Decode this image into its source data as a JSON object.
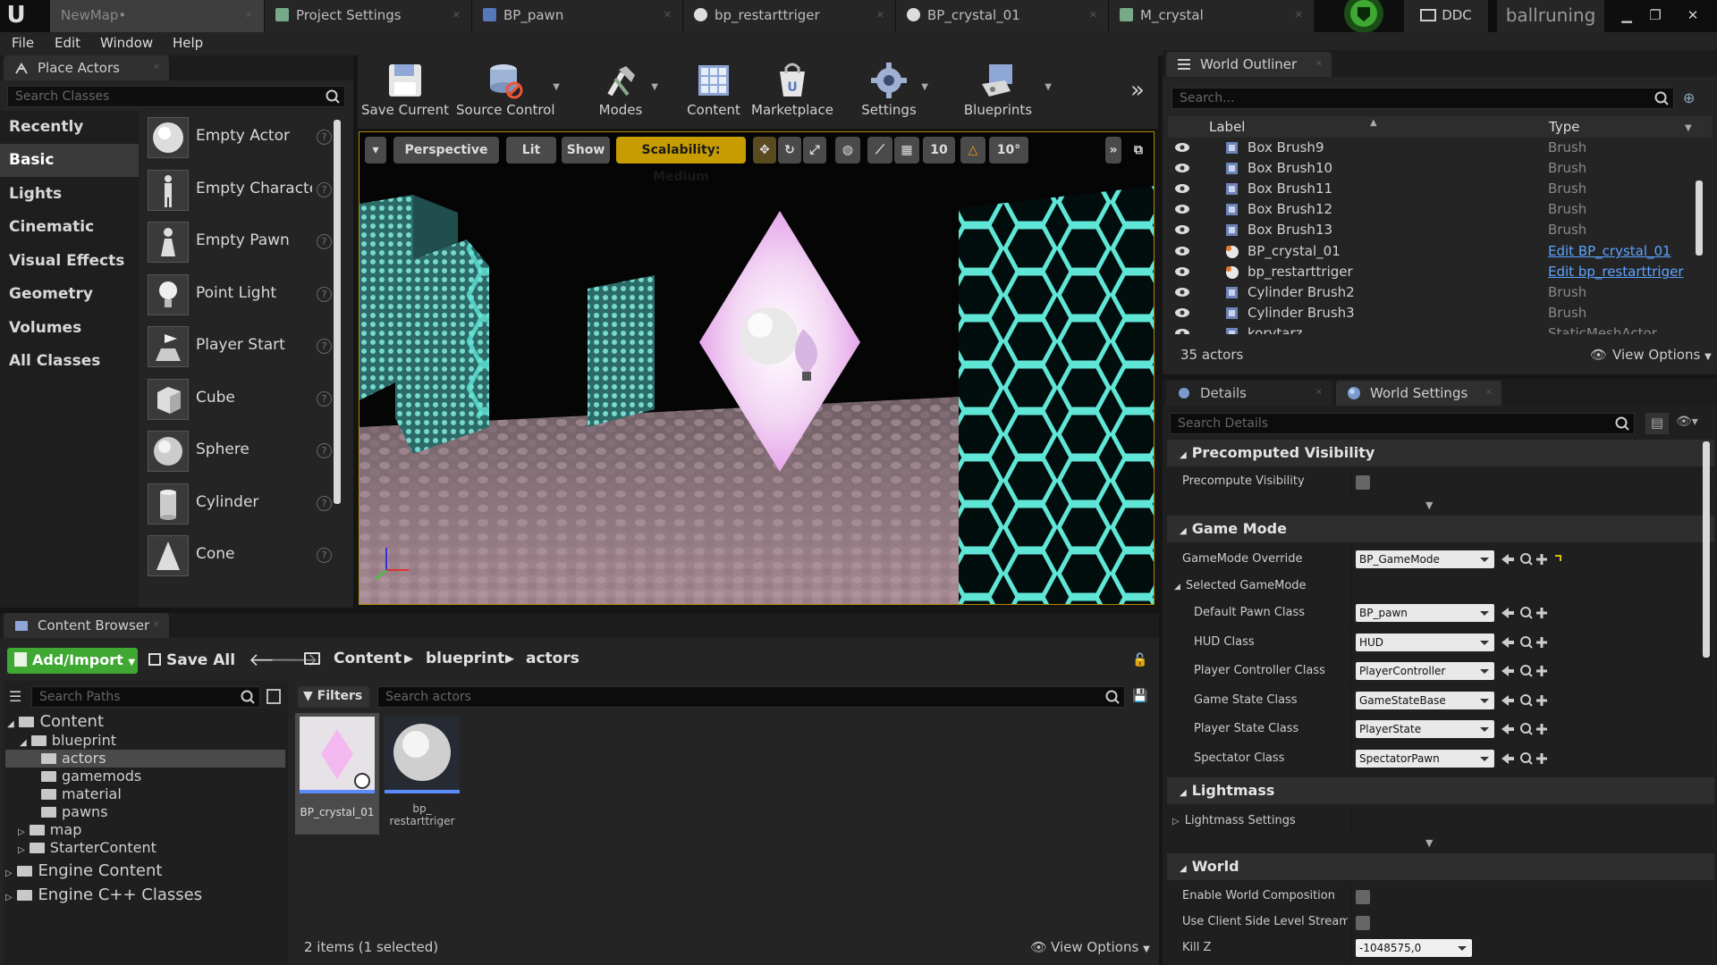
{
  "title_bar": {
    "tabs": [
      {
        "label": "NewMap•",
        "icon": "map-icon"
      },
      {
        "label": "Project Settings",
        "icon": "settings-icon"
      },
      {
        "label": "BP_pawn",
        "icon": "blueprint-icon"
      },
      {
        "label": "bp_restarttriger",
        "icon": "sphere-icon"
      },
      {
        "label": "BP_crystal_01",
        "icon": "sphere-icon"
      },
      {
        "label": "M_crystal",
        "icon": "material-icon"
      }
    ],
    "ddc_label": "DDC",
    "project_name": "ballruning"
  },
  "menu": [
    "File",
    "Edit",
    "Window",
    "Help"
  ],
  "place_actors": {
    "tab_label": "Place Actors",
    "search_placeholder": "Search Classes",
    "categories": [
      "Recently Placed",
      "Basic",
      "Lights",
      "Cinematic",
      "Visual Effects",
      "Geometry",
      "Volumes",
      "All Classes"
    ],
    "selected_category": "Basic",
    "actors": [
      "Empty Actor",
      "Empty Characte",
      "Empty Pawn",
      "Point Light",
      "Player Start",
      "Cube",
      "Sphere",
      "Cylinder",
      "Cone"
    ]
  },
  "toolbar": {
    "buttons": [
      "Save Current",
      "Source Control",
      "Modes",
      "Content",
      "Marketplace",
      "Settings",
      "Blueprints"
    ]
  },
  "viewport": {
    "perspective": "Perspective",
    "lit": "Lit",
    "show": "Show",
    "scalability": "Scalability: Medium",
    "grid_snap": "10",
    "rotation_snap": "10°"
  },
  "outliner": {
    "tab_label": "World Outliner",
    "search_placeholder": "Search...",
    "col_label": "Label",
    "col_type": "Type",
    "rows": [
      {
        "name": "Box Brush9",
        "type": "Brush",
        "link": false,
        "icon": "brush-icon"
      },
      {
        "name": "Box Brush10",
        "type": "Brush",
        "link": false,
        "icon": "brush-icon"
      },
      {
        "name": "Box Brush11",
        "type": "Brush",
        "link": false,
        "icon": "brush-icon"
      },
      {
        "name": "Box Brush12",
        "type": "Brush",
        "link": false,
        "icon": "brush-icon"
      },
      {
        "name": "Box Brush13",
        "type": "Brush",
        "link": false,
        "icon": "brush-icon"
      },
      {
        "name": "BP_crystal_01",
        "type": "Edit BP_crystal_01",
        "link": true,
        "icon": "blueprint-actor-icon"
      },
      {
        "name": "bp_restarttriger",
        "type": "Edit bp_restarttriger",
        "link": true,
        "icon": "blueprint-actor-icon"
      },
      {
        "name": "Cylinder Brush2",
        "type": "Brush",
        "link": false,
        "icon": "brush-icon"
      },
      {
        "name": "Cylinder Brush3",
        "type": "Brush",
        "link": false,
        "icon": "brush-icon"
      },
      {
        "name": "korytarz",
        "type": "StaticMeshActor",
        "link": false,
        "icon": "mesh-icon"
      }
    ],
    "count": "35 actors",
    "view_options": "View Options"
  },
  "details": {
    "tab_details": "Details",
    "tab_world": "World Settings",
    "search_placeholder": "Search Details",
    "sections": {
      "precomputed": "Precomputed Visibility",
      "gamemode": "Game Mode",
      "lightmass": "Lightmass",
      "world": "World"
    },
    "precompute_visibility": "Precompute Visibility",
    "gamemode_override": {
      "label": "GameMode Override",
      "value": "BP_GameMode"
    },
    "selected_gamemode": "Selected GameMode",
    "classes": [
      {
        "label": "Default Pawn Class",
        "value": "BP_pawn"
      },
      {
        "label": "HUD Class",
        "value": "HUD"
      },
      {
        "label": "Player Controller Class",
        "value": "PlayerController"
      },
      {
        "label": "Game State Class",
        "value": "GameStateBase"
      },
      {
        "label": "Player State Class",
        "value": "PlayerState"
      },
      {
        "label": "Spectator Class",
        "value": "SpectatorPawn"
      }
    ],
    "lightmass_settings": "Lightmass Settings",
    "enable_world_composition": "Enable World Composition",
    "client_side_streaming": "Use Client Side Level Streaming V",
    "kill_z": {
      "label": "Kill Z",
      "value": "-1048575,0"
    }
  },
  "content_browser": {
    "tab_label": "Content Browser",
    "add_import": "Add/Import",
    "save_all": "Save All",
    "breadcrumb": [
      "Content",
      "blueprint",
      "actors"
    ],
    "search_paths_placeholder": "Search Paths",
    "filters": "Filters",
    "search_placeholder": "Search actors",
    "tree": {
      "content": "Content",
      "blueprint": "blueprint",
      "actors": "actors",
      "gamemods": "gamemods",
      "material": "material",
      "pawns": "pawns",
      "map": "map",
      "starter": "StarterContent",
      "engine": "Engine Content",
      "cpp": "Engine C++ Classes"
    },
    "assets": [
      "BP_crystal_01",
      "bp_\nrestarttriger"
    ],
    "status": "2 items (1 selected)",
    "view_options": "View Options"
  },
  "colors": {
    "accent_green": "#3ea832",
    "scalability_yellow": "#c79c00",
    "link_blue": "#5ea3ff",
    "cyan_glow": "#5fe6d6"
  }
}
